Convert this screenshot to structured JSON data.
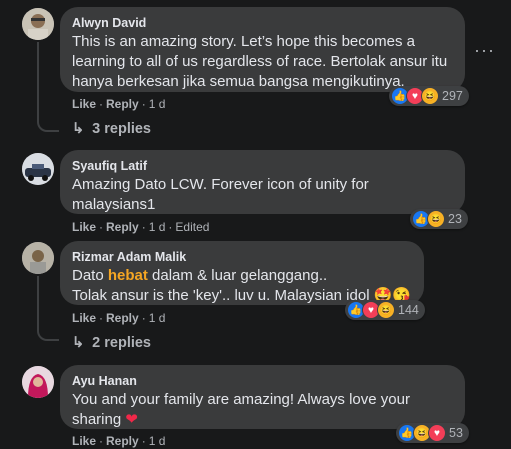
{
  "comments": [
    {
      "author": "Alwyn David",
      "text": "This is an amazing story. Let’s hope this becomes a learning to all of us regardless of race. Bertolak ansur itu hanya berkesan jika semua bangsa mengikutinya.",
      "like": "Like",
      "reply": "Reply",
      "time": "1 d",
      "reaction_count": "297",
      "replies_label": "3 replies"
    },
    {
      "author": "Syaufiq Latif",
      "text": "Amazing Dato LCW. Forever icon of unity for malaysians1",
      "like": "Like",
      "reply": "Reply",
      "time": "1 d",
      "edited": "Edited",
      "reaction_count": "23"
    },
    {
      "author": "Rizmar Adam Malik",
      "text_pre": "Dato ",
      "text_highlight": "hebat",
      "text_line1_post": " dalam & luar gelanggang..",
      "text_line2": "Tolak ansur is the 'key'.. luv u. Malaysian idol",
      "like": "Like",
      "reply": "Reply",
      "time": "1 d",
      "reaction_count": "144",
      "replies_label": "2 replies"
    },
    {
      "author": "Ayu Hanan",
      "text": "You and your family are amazing! Always love your sharing",
      "like": "Like",
      "reply": "Reply",
      "time": "1 d",
      "reaction_count": "53"
    }
  ],
  "icons": {
    "more": "more-options-icon",
    "reply_arrow": "reply-arrow-icon"
  },
  "colors": {
    "background": "#18191a",
    "bubble": "#3a3b3c",
    "highlight": "#f5a623",
    "like": "#1877f2",
    "love": "#f33e58",
    "haha": "#f7b125"
  }
}
